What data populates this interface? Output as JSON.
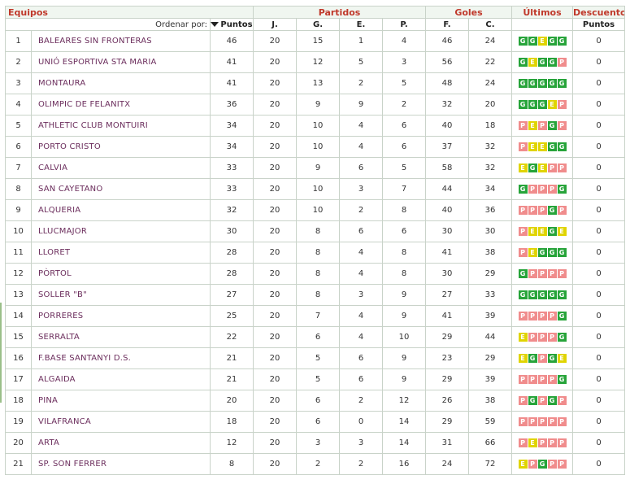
{
  "header": {
    "equipos": "Equipos",
    "partidos": "Partidos",
    "goles": "Goles",
    "ultimos": "Últimos",
    "descuento": "Descuento",
    "order_by": "Ordenar por:",
    "puntos": "Puntos",
    "j": "J.",
    "g": "G.",
    "e": "E.",
    "p": "P.",
    "f": "F.",
    "c": "C.",
    "desc_puntos": "Puntos"
  },
  "colors": {
    "win": "#27a43a",
    "draw": "#e0d400",
    "loss": "#f08c8c",
    "header_text": "#c0392b",
    "team_text": "#6b2d5c"
  },
  "rows": [
    {
      "pos": "1",
      "team": "BALEARES SIN FRONTERAS",
      "pts": "46",
      "j": "20",
      "g": "15",
      "e": "1",
      "p": "4",
      "f": "46",
      "c": "24",
      "last": "GGEGG",
      "desc": "0"
    },
    {
      "pos": "2",
      "team": "UNIÓ ESPORTIVA STA MARIA",
      "pts": "41",
      "j": "20",
      "g": "12",
      "e": "5",
      "p": "3",
      "f": "56",
      "c": "22",
      "last": "GEGGP",
      "desc": "0"
    },
    {
      "pos": "3",
      "team": "MONTAURA",
      "pts": "41",
      "j": "20",
      "g": "13",
      "e": "2",
      "p": "5",
      "f": "48",
      "c": "24",
      "last": "GGGGG",
      "desc": "0"
    },
    {
      "pos": "4",
      "team": "OLIMPIC DE FELANITX",
      "pts": "36",
      "j": "20",
      "g": "9",
      "e": "9",
      "p": "2",
      "f": "32",
      "c": "20",
      "last": "GGGEP",
      "desc": "0"
    },
    {
      "pos": "5",
      "team": "ATHLETIC CLUB MONTUIRI",
      "pts": "34",
      "j": "20",
      "g": "10",
      "e": "4",
      "p": "6",
      "f": "40",
      "c": "18",
      "last": "PEPGP",
      "desc": "0"
    },
    {
      "pos": "6",
      "team": "PORTO CRISTO",
      "pts": "34",
      "j": "20",
      "g": "10",
      "e": "4",
      "p": "6",
      "f": "37",
      "c": "32",
      "last": "PEEGG",
      "desc": "0"
    },
    {
      "pos": "7",
      "team": "CALVIA",
      "pts": "33",
      "j": "20",
      "g": "9",
      "e": "6",
      "p": "5",
      "f": "58",
      "c": "32",
      "last": "EGEPP",
      "desc": "0"
    },
    {
      "pos": "8",
      "team": "SAN CAYETANO",
      "pts": "33",
      "j": "20",
      "g": "10",
      "e": "3",
      "p": "7",
      "f": "44",
      "c": "34",
      "last": "GPPPG",
      "desc": "0"
    },
    {
      "pos": "9",
      "team": "ALQUERIA",
      "pts": "32",
      "j": "20",
      "g": "10",
      "e": "2",
      "p": "8",
      "f": "40",
      "c": "36",
      "last": "PPPGP",
      "desc": "0"
    },
    {
      "pos": "10",
      "team": "LLUCMAJOR",
      "pts": "30",
      "j": "20",
      "g": "8",
      "e": "6",
      "p": "6",
      "f": "30",
      "c": "30",
      "last": "PEEGE",
      "desc": "0"
    },
    {
      "pos": "11",
      "team": "LLORET",
      "pts": "28",
      "j": "20",
      "g": "8",
      "e": "4",
      "p": "8",
      "f": "41",
      "c": "38",
      "last": "PEGGG",
      "desc": "0"
    },
    {
      "pos": "12",
      "team": "PÒRTOL",
      "pts": "28",
      "j": "20",
      "g": "8",
      "e": "4",
      "p": "8",
      "f": "30",
      "c": "29",
      "last": "GPPPP",
      "desc": "0"
    },
    {
      "pos": "13",
      "team": "SOLLER \"B\"",
      "pts": "27",
      "j": "20",
      "g": "8",
      "e": "3",
      "p": "9",
      "f": "27",
      "c": "33",
      "last": "GGGGG",
      "desc": "0"
    },
    {
      "pos": "14",
      "team": "PORRERES",
      "pts": "25",
      "j": "20",
      "g": "7",
      "e": "4",
      "p": "9",
      "f": "41",
      "c": "39",
      "last": "PPPPG",
      "desc": "0"
    },
    {
      "pos": "15",
      "team": "SERRALTA",
      "pts": "22",
      "j": "20",
      "g": "6",
      "e": "4",
      "p": "10",
      "f": "29",
      "c": "44",
      "last": "EPPPG",
      "desc": "0"
    },
    {
      "pos": "16",
      "team": "F.BASE SANTANYI D.S.",
      "pts": "21",
      "j": "20",
      "g": "5",
      "e": "6",
      "p": "9",
      "f": "23",
      "c": "29",
      "last": "EGPGE",
      "desc": "0"
    },
    {
      "pos": "17",
      "team": "ALGAIDA",
      "pts": "21",
      "j": "20",
      "g": "5",
      "e": "6",
      "p": "9",
      "f": "29",
      "c": "39",
      "last": "PPPPG",
      "desc": "0"
    },
    {
      "pos": "18",
      "team": "PINA",
      "pts": "20",
      "j": "20",
      "g": "6",
      "e": "2",
      "p": "12",
      "f": "26",
      "c": "38",
      "last": "PGPGP",
      "desc": "0"
    },
    {
      "pos": "19",
      "team": "VILAFRANCA",
      "pts": "18",
      "j": "20",
      "g": "6",
      "e": "0",
      "p": "14",
      "f": "29",
      "c": "59",
      "last": "PPPPP",
      "desc": "0"
    },
    {
      "pos": "20",
      "team": "ARTA",
      "pts": "12",
      "j": "20",
      "g": "3",
      "e": "3",
      "p": "14",
      "f": "31",
      "c": "66",
      "last": "PEPPP",
      "desc": "0"
    },
    {
      "pos": "21",
      "team": "SP. SON FERRER",
      "pts": "8",
      "j": "20",
      "g": "2",
      "e": "2",
      "p": "16",
      "f": "24",
      "c": "72",
      "last": "EPGPP",
      "desc": "0"
    }
  ]
}
